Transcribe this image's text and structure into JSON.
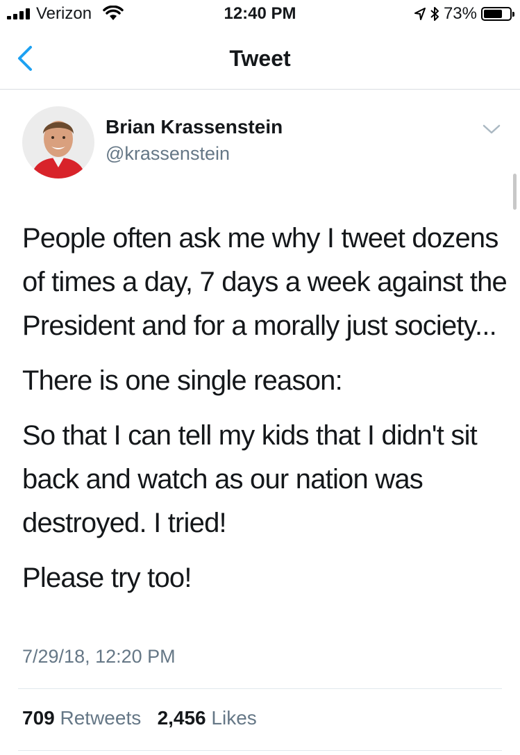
{
  "status_bar": {
    "carrier": "Verizon",
    "time": "12:40 PM",
    "battery": "73%",
    "battery_level": 0.73,
    "icons": [
      "signal-icon",
      "wifi-icon",
      "location-icon",
      "bluetooth-icon",
      "battery-icon"
    ]
  },
  "nav": {
    "title": "Tweet",
    "back_icon": "chevron-left-icon"
  },
  "author": {
    "name": "Brian Krassenstein",
    "handle": "@krassenstein",
    "menu_icon": "chevron-down-icon"
  },
  "tweet": {
    "paragraphs": [
      "People often ask me why I tweet dozens of times a day, 7 days a week against the President and for a morally just society...",
      "There is one single reason:",
      "So that I can tell my kids that I didn't sit back and watch as our nation was destroyed. I tried!",
      "Please try too!"
    ],
    "timestamp": "7/29/18, 12:20 PM"
  },
  "stats": {
    "retweets_count": "709",
    "retweets_label": "Retweets",
    "likes_count": "2,456",
    "likes_label": "Likes"
  },
  "colors": {
    "accent": "#1da1f2",
    "secondary_text": "#657786",
    "divider": "#e1e8ed"
  }
}
